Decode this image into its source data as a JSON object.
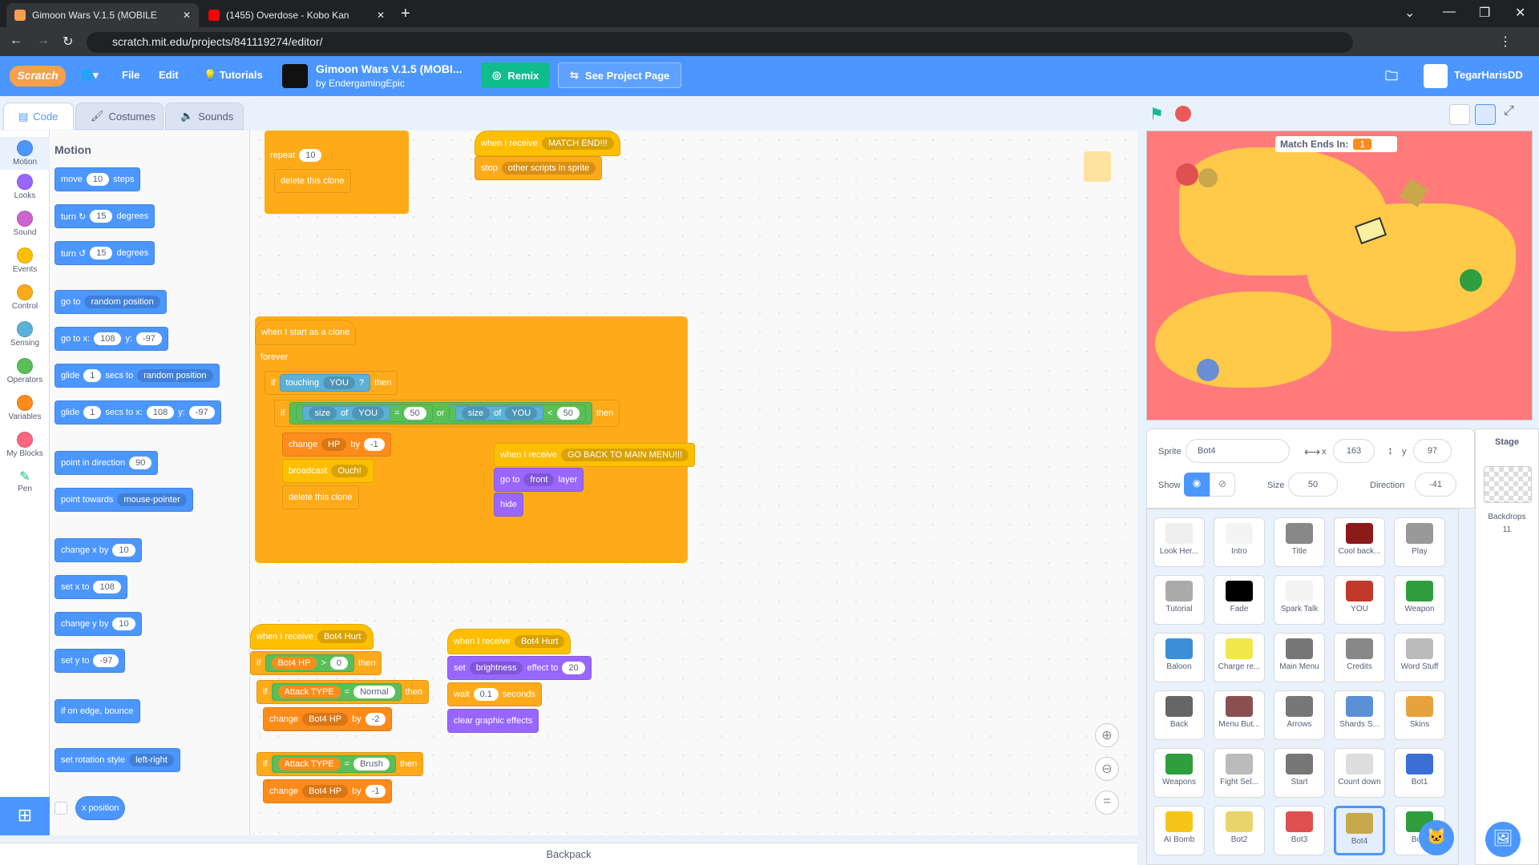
{
  "browser": {
    "tabs": [
      {
        "title": "Gimoon Wars V.1.5 (MOBILE"
      },
      {
        "title": "(1455) Overdose - Kobo Kan"
      }
    ],
    "url": "scratch.mit.edu/projects/841119274/editor/"
  },
  "menu": {
    "logo": "Scratch",
    "file": "File",
    "edit": "Edit",
    "tutorials": "Tutorials",
    "project_title": "Gimoon Wars V.1.5 (MOBI...",
    "project_author": "by EndergamingEpic",
    "remix": "Remix",
    "see_project": "See Project Page",
    "username": "TegarHarisDD"
  },
  "editor_tabs": {
    "code": "Code",
    "costumes": "Costumes",
    "sounds": "Sounds"
  },
  "categories": [
    {
      "label": "Motion",
      "color": "#4c97ff"
    },
    {
      "label": "Looks",
      "color": "#9966ff"
    },
    {
      "label": "Sound",
      "color": "#cf63cf"
    },
    {
      "label": "Events",
      "color": "#ffbf00"
    },
    {
      "label": "Control",
      "color": "#ffab19"
    },
    {
      "label": "Sensing",
      "color": "#5cb1d6"
    },
    {
      "label": "Operators",
      "color": "#59c059"
    },
    {
      "label": "Variables",
      "color": "#ff8c1a"
    },
    {
      "label": "My Blocks",
      "color": "#ff6680"
    },
    {
      "label": "Pen",
      "color": "#0fbd8c"
    }
  ],
  "palette": {
    "heading": "Motion",
    "blocks": [
      {
        "t": "move",
        "v1": "10",
        "t2": "steps"
      },
      {
        "t": "turn ↻",
        "v1": "15",
        "t2": "degrees"
      },
      {
        "t": "turn ↺",
        "v1": "15",
        "t2": "degrees"
      },
      {
        "t": "go to",
        "dd": "random position"
      },
      {
        "t": "go to x:",
        "v1": "108",
        "t2": "y:",
        "v2": "-97"
      },
      {
        "t": "glide",
        "v1": "1",
        "t2": "secs to",
        "dd": "random position"
      },
      {
        "t": "glide",
        "v1": "1",
        "t2": "secs to x:",
        "v2": "108",
        "t3": "y:",
        "v3": "-97"
      },
      {
        "t": "point in direction",
        "v1": "90"
      },
      {
        "t": "point towards",
        "dd": "mouse-pointer"
      },
      {
        "t": "change x by",
        "v1": "10"
      },
      {
        "t": "set x to",
        "v1": "108"
      },
      {
        "t": "change y by",
        "v1": "10"
      },
      {
        "t": "set y to",
        "v1": "-97"
      },
      {
        "t": "if on edge, bounce"
      },
      {
        "t": "set rotation style",
        "dd": "left-right"
      },
      {
        "t": "x position"
      }
    ]
  },
  "scripts": {
    "s1": {
      "repeat": "repeat",
      "repeat_val": "10",
      "delete_clone": "delete this clone"
    },
    "s2": {
      "when_receive": "when I receive",
      "msg": "MATCH END!!!",
      "stop": "stop",
      "stop_dd": "other scripts in sprite"
    },
    "s3": {
      "hat": "when I start as a clone",
      "forever": "forever",
      "if": "if",
      "touching": "touching",
      "you": "YOU",
      "q": "?",
      "then": "then",
      "size": "size",
      "of": "of",
      "eq": "=",
      "fifty": "50",
      "or": "or",
      "lt": "<",
      "change": "change",
      "hp": "HP",
      "by": "by",
      "neg1": "-1",
      "broadcast": "broadcast",
      "ouch": "Ouch!",
      "delete": "delete this clone"
    },
    "s4": {
      "when_receive": "when I receive",
      "msg": "GO BACK TO MAIN MENU!!!",
      "goto": "go to",
      "front": "front",
      "layer": "layer",
      "hide": "hide"
    },
    "s5": {
      "when_receive": "when I receive",
      "msg": "Bot4 Hurt",
      "bot4hp": "Bot4 HP",
      "gt": ">",
      "zero": "0",
      "then": "then",
      "attack": "Attack TYPE",
      "eq": "=",
      "normal": "Normal",
      "change": "change",
      "by": "by",
      "neg2": "-2",
      "brush": "Brush",
      "neg1": "-1",
      "if": "if"
    },
    "s6": {
      "when_receive": "when I receive",
      "msg": "Bot4 Hurt",
      "set": "set",
      "brightness": "brightness",
      "effect_to": "effect to",
      "val": "20",
      "wait": "wait",
      "wait_val": "0.1",
      "seconds": "seconds",
      "clear": "clear graphic effects"
    }
  },
  "stage": {
    "match_label": "Match Ends In:",
    "match_val": "1"
  },
  "sprite_info": {
    "sprite_label": "Sprite",
    "sprite_name": "Bot4",
    "x_label": "x",
    "x_val": "163",
    "y_label": "y",
    "y_val": "97",
    "show_label": "Show",
    "size_label": "Size",
    "size_val": "50",
    "direction_label": "Direction",
    "direction_val": "-41"
  },
  "sprites": [
    {
      "name": "Look Her...",
      "color": "#eeeeee"
    },
    {
      "name": "Intro",
      "color": "#f4f4f4"
    },
    {
      "name": "Title",
      "color": "#888888"
    },
    {
      "name": "Cool back...",
      "color": "#8b1a1a"
    },
    {
      "name": "Play",
      "color": "#999999"
    },
    {
      "name": "Tutorial",
      "color": "#aaaaaa"
    },
    {
      "name": "Fade",
      "color": "#000000"
    },
    {
      "name": "Spark Talk",
      "color": "#f4f4f4"
    },
    {
      "name": "YOU",
      "color": "#c0392b"
    },
    {
      "name": "Weapon",
      "color": "#2e9e3e"
    },
    {
      "name": "Baloon",
      "color": "#3b8fd6"
    },
    {
      "name": "Charge re...",
      "color": "#f1e74a"
    },
    {
      "name": "Main Menu",
      "color": "#777777"
    },
    {
      "name": "Credits",
      "color": "#888888"
    },
    {
      "name": "Word Stuff",
      "color": "#bbbbbb"
    },
    {
      "name": "Back",
      "color": "#666666"
    },
    {
      "name": "Menu But...",
      "color": "#8a5050"
    },
    {
      "name": "Arrows",
      "color": "#777777"
    },
    {
      "name": "Shards S...",
      "color": "#5b8fd6"
    },
    {
      "name": "Skins",
      "color": "#e6a23c"
    },
    {
      "name": "Weapons",
      "color": "#2e9e3e"
    },
    {
      "name": "Fight Sel...",
      "color": "#bbbbbb"
    },
    {
      "name": "Start",
      "color": "#777777"
    },
    {
      "name": "Count down",
      "color": "#dddddd"
    },
    {
      "name": "Bot1",
      "color": "#3b6fd6"
    },
    {
      "name": "AI Bomb",
      "color": "#f5c518"
    },
    {
      "name": "Bot2",
      "color": "#e8d46a"
    },
    {
      "name": "Bot3",
      "color": "#e05050"
    },
    {
      "name": "Bot4",
      "color": "#c8a84a"
    },
    {
      "name": "Bot5",
      "color": "#2e9e3e"
    }
  ],
  "stage_panel": {
    "label": "Stage",
    "backdrops_label": "Backdrops",
    "backdrops_count": "11"
  },
  "backpack": "Backpack"
}
